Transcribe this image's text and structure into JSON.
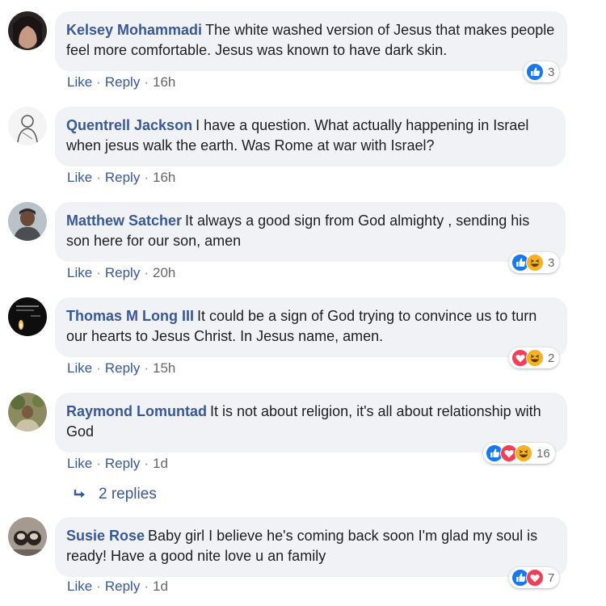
{
  "comments": [
    {
      "author": "Kelsey Mohammadi",
      "text": "The white washed version of Jesus that makes people feel more comfortable. Jesus was known to have dark skin.",
      "like_label": "Like",
      "reply_label": "Reply",
      "time": "16h",
      "reaction_count": "3",
      "reactions": [
        "like-icon"
      ]
    },
    {
      "author": "Quentrell Jackson",
      "text": "I have a question. What actually happening in Israel when jesus walk the earth. Was Rome at war with Israel?",
      "like_label": "Like",
      "reply_label": "Reply",
      "time": "16h"
    },
    {
      "author": "Matthew Satcher",
      "text": "It always a good sign from God almighty , sending his son here for our son, amen",
      "like_label": "Like",
      "reply_label": "Reply",
      "time": "20h",
      "reaction_count": "3",
      "reactions": [
        "like-icon",
        "haha-icon"
      ]
    },
    {
      "author": "Thomas M Long III",
      "text": "It could be a sign of God trying to convince us to turn our hearts to Jesus Christ. In Jesus name, amen.",
      "like_label": "Like",
      "reply_label": "Reply",
      "time": "15h",
      "reaction_count": "2",
      "reactions": [
        "love-icon",
        "haha-icon"
      ]
    },
    {
      "author": "Raymond Lomuntad",
      "text": "It is not about religion, it's all about relationship with God",
      "like_label": "Like",
      "reply_label": "Reply",
      "time": "1d",
      "reaction_count": "16",
      "reactions": [
        "like-icon",
        "love-icon",
        "haha-icon"
      ]
    },
    {
      "author": "Susie Rose",
      "text": "Baby girl I believe he's coming back soon I'm glad my soul is ready! Have a good nite love u an family",
      "like_label": "Like",
      "reply_label": "Reply",
      "time": "1d",
      "reaction_count": "7",
      "reactions": [
        "like-icon",
        "love-icon"
      ]
    }
  ],
  "replies_link": {
    "label": "2 replies",
    "icon": "reply-arrow-icon"
  },
  "colors": {
    "author": "#385898",
    "bubble": "#f0f2f5",
    "like": "#1877f2",
    "love": "#f33e58",
    "haha": "#f7b125"
  }
}
